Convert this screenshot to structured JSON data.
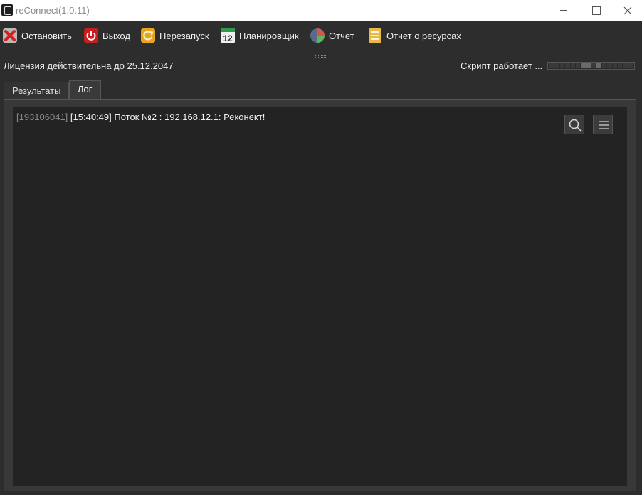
{
  "window": {
    "title": "reConnect(1.0.11)"
  },
  "toolbar": {
    "stop": "Остановить",
    "exit": "Выход",
    "restart": "Перезапуск",
    "scheduler": "Планировщик",
    "scheduler_icon_number": "12",
    "report": "Отчет",
    "resource_report": "Отчет о ресурсах"
  },
  "status": {
    "license": "Лицензия действительна до 25.12.2047",
    "script": "Скрипт работает ..."
  },
  "tabs": [
    {
      "label": "Результаты",
      "active": false
    },
    {
      "label": "Лог",
      "active": true
    }
  ],
  "log": {
    "lines": [
      {
        "id": "[193106041]",
        "message": "[15:40:49] Поток №2 : 192.168.12.1: Реконект!"
      }
    ]
  },
  "icons": {
    "stop": "red-x-icon",
    "exit": "power-icon",
    "restart": "refresh-icon",
    "scheduler": "calendar-icon",
    "report": "pie-chart-icon",
    "resource_report": "document-list-icon",
    "search": "search-icon",
    "menu": "hamburger-menu-icon"
  }
}
